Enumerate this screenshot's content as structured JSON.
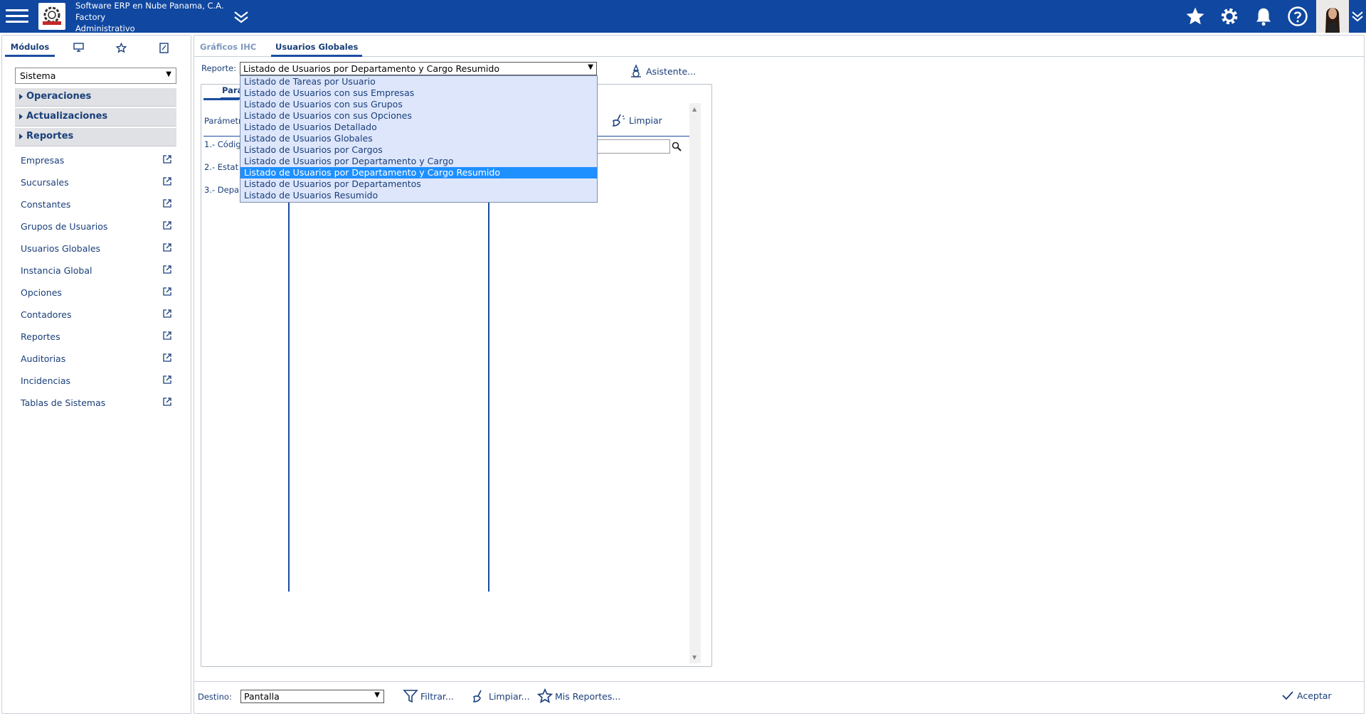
{
  "header": {
    "company_line1": "Software ERP en Nube Panama, C.A.",
    "company_line2": "Factory",
    "company_line3": "Administrativo",
    "icons": [
      "menu-icon",
      "logo",
      "double-chevron-down-icon",
      "star-icon",
      "gear-icon",
      "bell-icon",
      "help-icon",
      "avatar",
      "chevron-down-icon"
    ]
  },
  "sidebar": {
    "tabs": [
      {
        "label": "Módulos"
      },
      {
        "icon": "monitor-icon"
      },
      {
        "icon": "star-icon"
      },
      {
        "icon": "document-icon"
      }
    ],
    "module_select": "Sistema",
    "groups": [
      {
        "label": "Operaciones"
      },
      {
        "label": "Actualizaciones"
      },
      {
        "label": "Reportes"
      }
    ],
    "items": [
      {
        "label": "Empresas"
      },
      {
        "label": "Sucursales"
      },
      {
        "label": "Constantes"
      },
      {
        "label": "Grupos de Usuarios"
      },
      {
        "label": "Usuarios Globales"
      },
      {
        "label": "Instancia Global"
      },
      {
        "label": "Opciones"
      },
      {
        "label": "Contadores"
      },
      {
        "label": "Reportes"
      },
      {
        "label": "Auditorias"
      },
      {
        "label": "Incidencias"
      },
      {
        "label": "Tablas de Sistemas"
      }
    ]
  },
  "main": {
    "tabs": [
      {
        "label": "Gráficos IHC"
      },
      {
        "label": "Usuarios Globales"
      }
    ],
    "reporte_label": "Reporte:",
    "reporte_value": "Listado de Usuarios por Departamento y Cargo Resumido",
    "reporte_options": [
      "Listado de Tareas por Usuario",
      "Listado de Usuarios con sus Empresas",
      "Listado de Usuarios con sus Grupos",
      "Listado de Usuarios con sus Opciones",
      "Listado de Usuarios Detallado",
      "Listado de Usuarios Globales",
      "Listado de Usuarios por Cargos",
      "Listado de Usuarios por Departamento y Cargo",
      "Listado de Usuarios por Departamento y Cargo Resumido",
      "Listado de Usuarios por Departamentos",
      "Listado de Usuarios Resumido"
    ],
    "asistente_label": "Asistente...",
    "inner_tab_label": "Pará",
    "parametros_label": "Parámetr",
    "limpiar_label": "Limpiar",
    "params": [
      {
        "label": "1.- Códig"
      },
      {
        "label": "2.- Estat"
      },
      {
        "label": "3.- Depa"
      }
    ]
  },
  "footer": {
    "destino_label": "Destino:",
    "destino_value": "Pantalla",
    "filtrar_label": "Filtrar...",
    "limpiar_label": "Limpiar...",
    "mis_reportes_label": "Mis Reportes...",
    "aceptar_label": "Aceptar"
  },
  "colors": {
    "header_bg": "#0f47a1",
    "text_primary": "#1a3f7a",
    "selected_option": "#1e90ff",
    "dropdown_bg": "#dde6fb"
  }
}
